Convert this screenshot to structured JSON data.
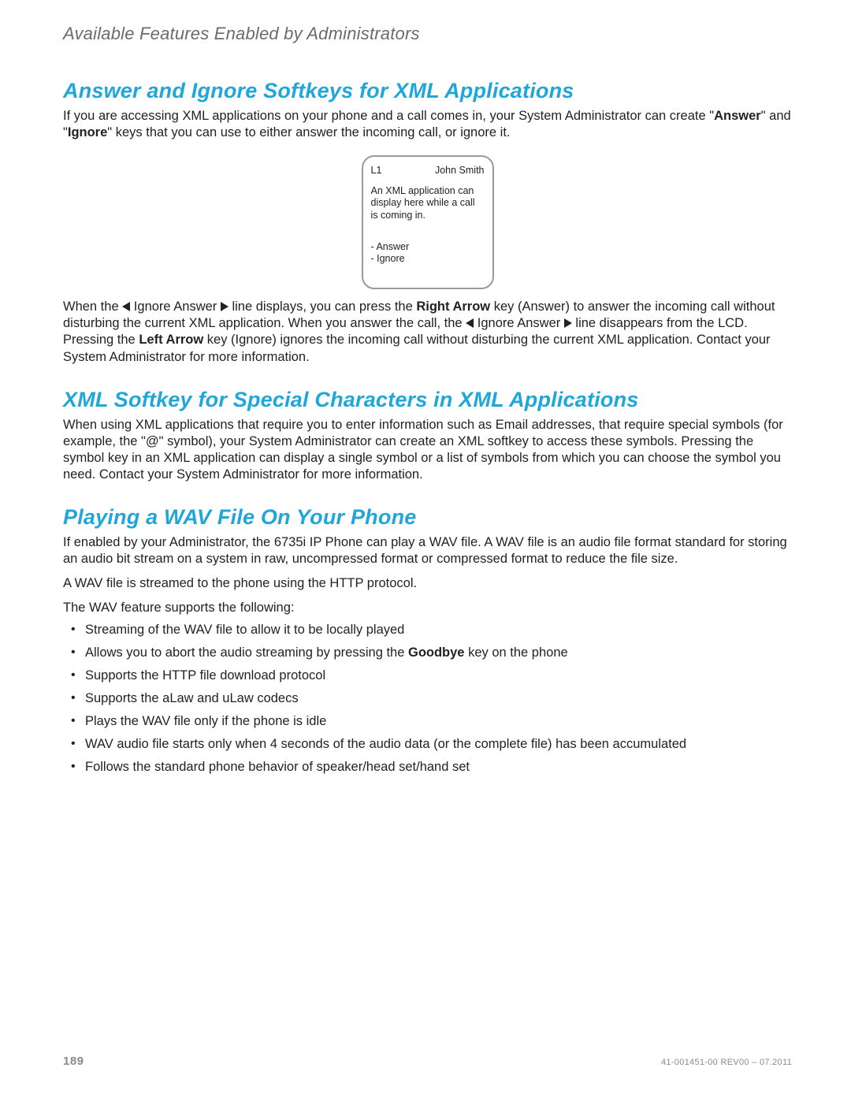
{
  "header": {
    "title": "Available Features Enabled by Administrators"
  },
  "sections": {
    "answer_ignore": {
      "title": "Answer and Ignore Softkeys for XML Applications",
      "intro_before_answer": "If you are accessing XML applications on your phone and a call comes in, your System Administrator can create \"",
      "answer_word": "Answer",
      "intro_between": "\" and \"",
      "ignore_word": "Ignore",
      "intro_after": "\" keys that you can use to either answer the incoming call, or ignore it.",
      "screen": {
        "line": "L1",
        "caller": "John Smith",
        "message": "An XML application can display here while a call is coming in.",
        "softkey1": "- Answer",
        "softkey2": "- Ignore"
      },
      "para2": {
        "p1": "When the ",
        "p2": " Ignore Answer ",
        "p3": " line displays, you can press the ",
        "right_arrow": "Right Arrow",
        "p4": " key (Answer) to answer the incoming call without disturbing the current XML application. When you answer the call, the ",
        "p5": " Ignore Answer ",
        "p6": " line disappears from the LCD. Pressing the ",
        "left_arrow": "Left Arrow",
        "p7": " key (Ignore) ignores the incoming call without disturbing the current XML application. Contact your System Administrator for more information."
      }
    },
    "xml_softkey": {
      "title": "XML Softkey for Special Characters in XML Applications",
      "para": "When using XML applications that require you to enter information such as Email addresses, that require special symbols (for example, the \"@\" symbol), your System Administrator can create an XML softkey to access these symbols. Pressing the symbol key in an XML application can display a single symbol or a list of symbols from which you can choose the symbol you need. Contact your System Administrator for more information."
    },
    "wav": {
      "title": "Playing a WAV File On Your Phone",
      "para1": "If enabled by your Administrator, the 6735i IP Phone can play a WAV file. A WAV file is an audio file format standard for storing an audio bit stream on a system in raw, uncompressed format or compressed format to reduce the file size.",
      "para2": "A WAV file is streamed to the phone using the HTTP protocol.",
      "para3": "The WAV feature supports the following:",
      "bullets": [
        "Streaming of the WAV file to allow it to be locally played",
        {
          "pre": "Allows you to abort the audio streaming by pressing the ",
          "bold": "Goodbye",
          "post": " key on the phone"
        },
        "Supports the HTTP file download protocol",
        "Supports the aLaw and uLaw codecs",
        "Plays the WAV file only if the phone is idle",
        "WAV audio file starts only when 4 seconds of the audio data (or the complete file) has been accumulated",
        "Follows the standard phone behavior of speaker/head set/hand set"
      ]
    }
  },
  "footer": {
    "page": "189",
    "docref": "41-001451-00 REV00 – 07.2011"
  }
}
